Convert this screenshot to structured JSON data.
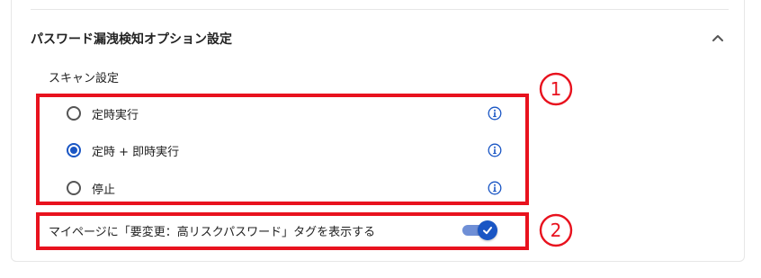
{
  "section": {
    "title": "パスワード漏洩検知オプション設定",
    "expanded": true
  },
  "scan_settings": {
    "label": "スキャン設定",
    "options": [
      {
        "label": "定時実行",
        "selected": false
      },
      {
        "label": "定時 + 即時実行",
        "selected": true
      },
      {
        "label": "停止",
        "selected": false
      }
    ]
  },
  "mypage_tag": {
    "label": "マイページに「要変更：高リスクパスワード」タグを表示する",
    "enabled": true
  },
  "annotations": {
    "marker_1": "①",
    "marker_2": "②"
  },
  "colors": {
    "accent": "#1a56c4",
    "annotation_red": "#e8121e",
    "toggle_track": "#6f8fd6",
    "border": "#e6e6e6"
  },
  "icons": {
    "collapse": "chevron-up-icon",
    "info": "info-icon",
    "check": "check-icon"
  }
}
